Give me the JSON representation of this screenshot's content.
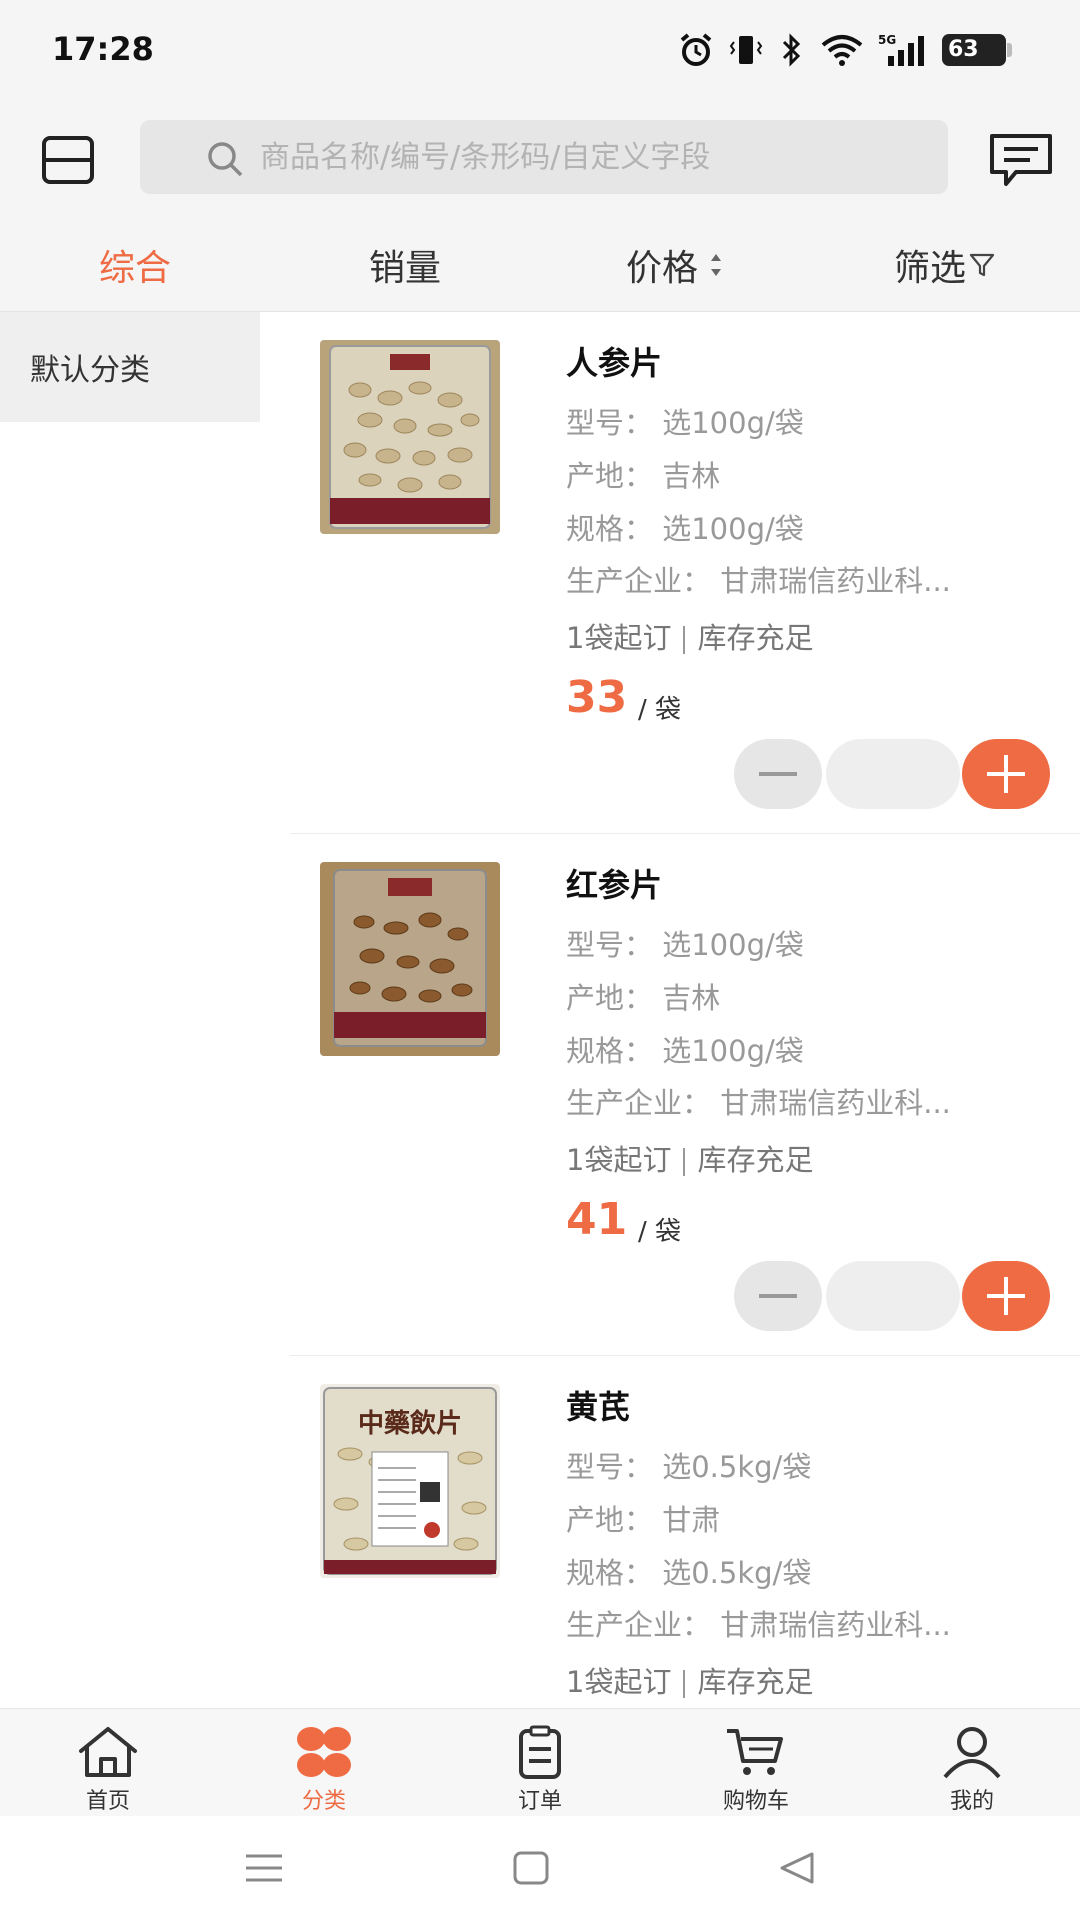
{
  "status_bar": {
    "time": "17:28",
    "network": "5G",
    "battery": "63"
  },
  "search": {
    "placeholder": "商品名称/编号/条形码/自定义字段"
  },
  "sort_tabs": [
    {
      "label": "综合",
      "active": true
    },
    {
      "label": "销量",
      "active": false
    },
    {
      "label": "价格",
      "active": false
    },
    {
      "label": "筛选",
      "active": false
    }
  ],
  "categories": [
    {
      "label": "默认分类",
      "selected": true
    }
  ],
  "labels": {
    "model": "型号：",
    "origin": "产地：",
    "spec": "规格：",
    "maker": "生产企业：",
    "moq": "1袋起订",
    "stock": "库存充足"
  },
  "products": [
    {
      "name": "人参片",
      "model": "选100g/袋",
      "origin": "吉林",
      "spec": "选100g/袋",
      "maker": "甘肃瑞信药业科...",
      "price": "33",
      "unit": "/ 袋",
      "image": "sliced-ginseng-bag"
    },
    {
      "name": "红参片",
      "model": "选100g/袋",
      "origin": "吉林",
      "spec": "选100g/袋",
      "maker": "甘肃瑞信药业科...",
      "price": "41",
      "unit": "/ 袋",
      "image": "red-ginseng-bag"
    },
    {
      "name": "黄芪",
      "model": "选0.5kg/袋",
      "origin": "甘肃",
      "spec": "选0.5kg/袋",
      "maker": "甘肃瑞信药业科...",
      "image_text": "中藥飲片",
      "image": "astragalus-bag"
    }
  ],
  "bottom_nav": [
    {
      "label": "首页",
      "icon": "home-icon",
      "active": false
    },
    {
      "label": "分类",
      "icon": "category-icon",
      "active": true
    },
    {
      "label": "订单",
      "icon": "order-icon",
      "active": false
    },
    {
      "label": "购物车",
      "icon": "cart-icon",
      "active": false
    },
    {
      "label": "我的",
      "icon": "user-icon",
      "active": false
    }
  ],
  "colors": {
    "accent": "#ee6b44",
    "text": "#222222",
    "muted": "#999999",
    "background": "#f5f5f5"
  }
}
